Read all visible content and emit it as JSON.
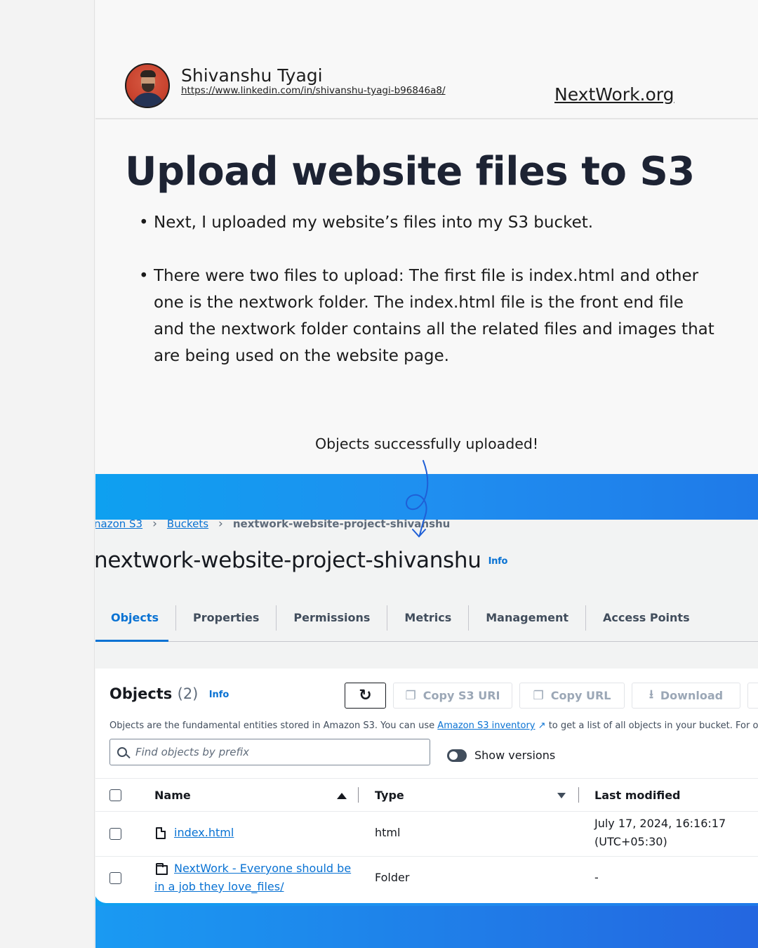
{
  "author": {
    "name": "Shivanshu Tyagi",
    "profile_url": "https://www.linkedin.com/in/shivanshu-tyagi-b96846a8/"
  },
  "brand": "NextWork.org",
  "title": "Upload website files to S3",
  "bullets": [
    "Next, I uploaded my website’s files into my S3 bucket.",
    "There were two files to upload: The first file is index.html and other one is the nextwork folder. The index.html file is the front end file and the nextwork folder contains all the related files and images that are being used on the website page."
  ],
  "caption": "Objects successfully uploaded!",
  "console": {
    "breadcrumb": [
      "nazon S3",
      "Buckets",
      "nextwork-website-project-shivanshu"
    ],
    "bucket_name": "nextwork-website-project-shivanshu",
    "info_label": "Info",
    "tabs": [
      "Objects",
      "Properties",
      "Permissions",
      "Metrics",
      "Management",
      "Access Points"
    ],
    "active_tab": "Objects",
    "objects_heading": "Objects",
    "objects_count": "(2)",
    "buttons": {
      "refresh_icon": "refresh-icon",
      "copy_s3_uri": "Copy S3 URI",
      "copy_url": "Copy URL",
      "download": "Download"
    },
    "description_prefix": "Objects are the fundamental entities stored in Amazon S3. You can use",
    "description_link": "Amazon S3 inventory",
    "description_suffix": "to get a list of all objects in your bucket. For ot",
    "search_placeholder": "Find objects by prefix",
    "show_versions_label": "Show versions",
    "show_versions_on": false,
    "columns": [
      "Name",
      "Type",
      "Last modified"
    ],
    "rows": [
      {
        "name": "index.html",
        "icon": "file-icon",
        "type": "html",
        "last_modified_line1": "July 17, 2024, 16:16:17",
        "last_modified_line2": "(UTC+05:30)"
      },
      {
        "name_line1": "NextWork - Everyone should be",
        "name_line2": "in a job they love_files/",
        "icon": "folder-icon",
        "type": "Folder",
        "last_modified": "-"
      }
    ]
  },
  "colors": {
    "accent_blue": "#0972d3",
    "title_navy": "#1d2333",
    "band_blue": "#1f8ff0"
  }
}
